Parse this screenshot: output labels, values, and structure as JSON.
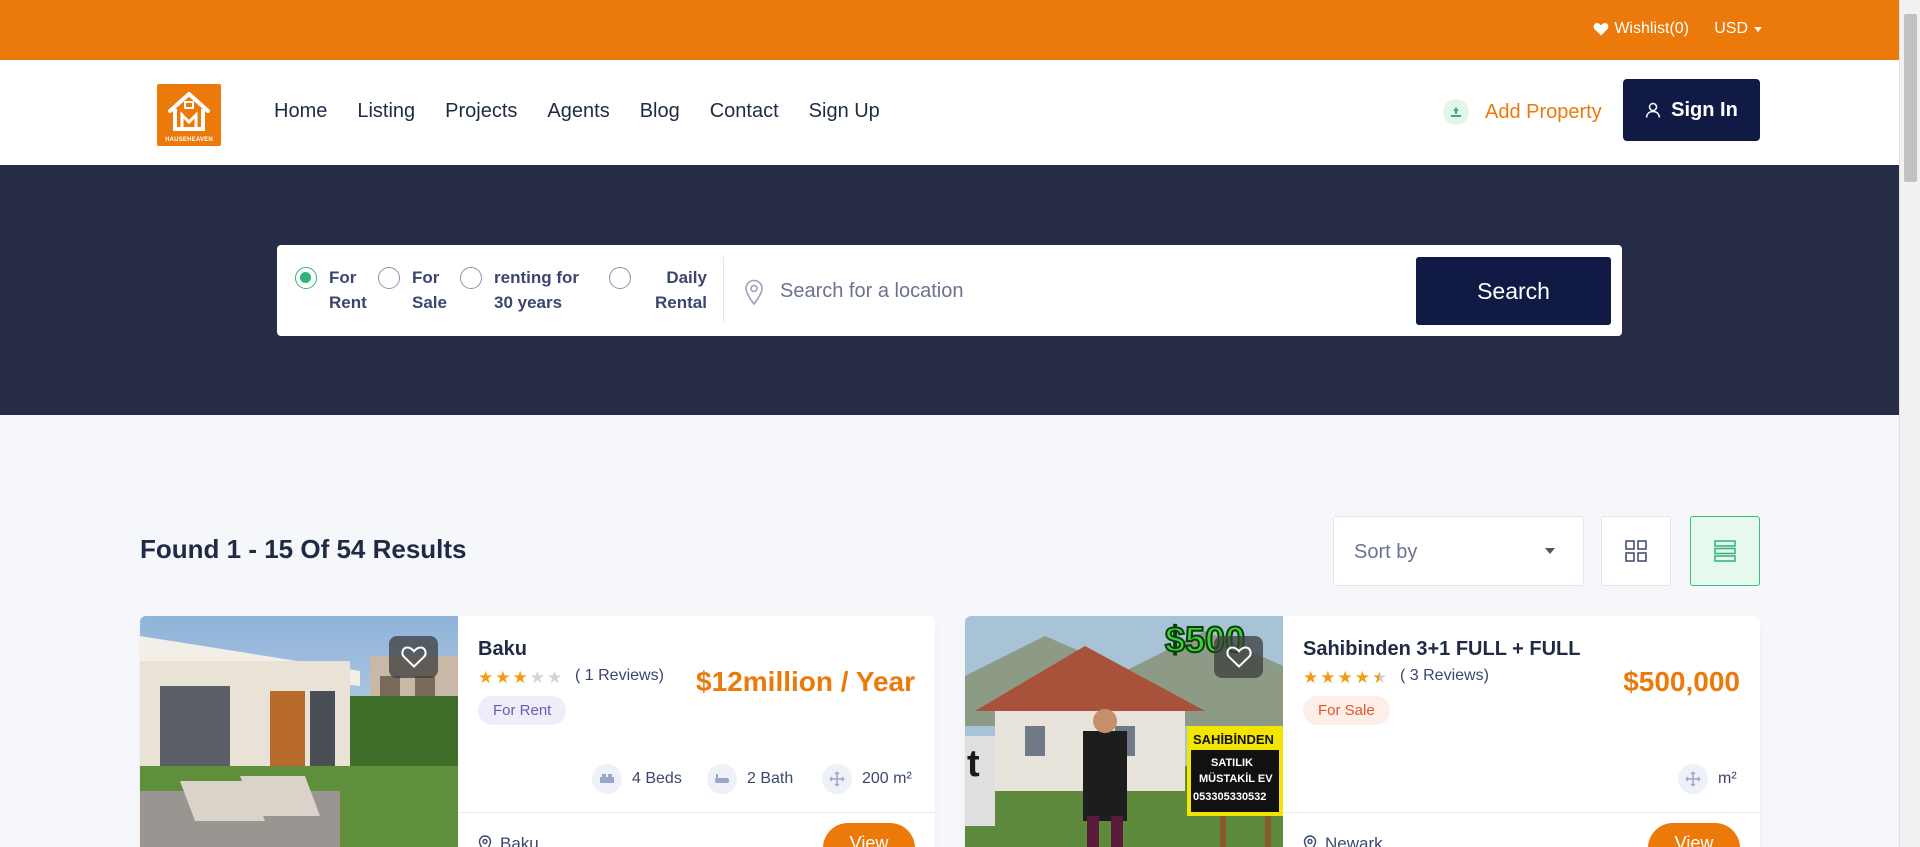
{
  "topbar": {
    "wishlist": "Wishlist(0)",
    "currency": "USD"
  },
  "header": {
    "logo_text": "HAUSEHEAVEN",
    "nav": [
      "Home",
      "Listing",
      "Projects",
      "Agents",
      "Blog",
      "Contact",
      "Sign Up"
    ],
    "add_property": "Add Property",
    "sign_in": "Sign In"
  },
  "search": {
    "options": [
      {
        "line1": "For",
        "line2": "Rent",
        "selected": true
      },
      {
        "line1": "For",
        "line2": "Sale",
        "selected": false
      },
      {
        "line1": "renting for",
        "line2": "30 years",
        "selected": false
      },
      {
        "line1": "Daily",
        "line2": "Rental",
        "selected": false
      }
    ],
    "placeholder": "Search for a location",
    "button": "Search"
  },
  "results": {
    "found": "Found 1 - 15 Of 54 Results",
    "sort_label": "Sort by"
  },
  "listings": [
    {
      "title": "Baku",
      "rating": 3,
      "reviews": "( 1 Reviews)",
      "badge": "For Rent",
      "price": "$12million / Year",
      "beds": "4 Beds",
      "bath": "2 Bath",
      "area": "200 m²",
      "location": "Baku",
      "view": "View"
    },
    {
      "title": "Sahibinden 3+1 FULL + FULL",
      "rating": 4.5,
      "reviews": "( 3 Reviews)",
      "badge": "For Sale",
      "price": "$500,000",
      "area": "m²",
      "location": "Newark",
      "view": "View",
      "image_text": [
        "$500",
        "SAHİBİNDEN",
        "SATILIK",
        "MÜSTAKİL EV",
        "05330533053​2"
      ]
    }
  ],
  "colors": {
    "brand_orange": "#eb7a0a",
    "navy": "#101a45",
    "hero_bg": "#262c45",
    "accent_green": "#2fb37a"
  }
}
